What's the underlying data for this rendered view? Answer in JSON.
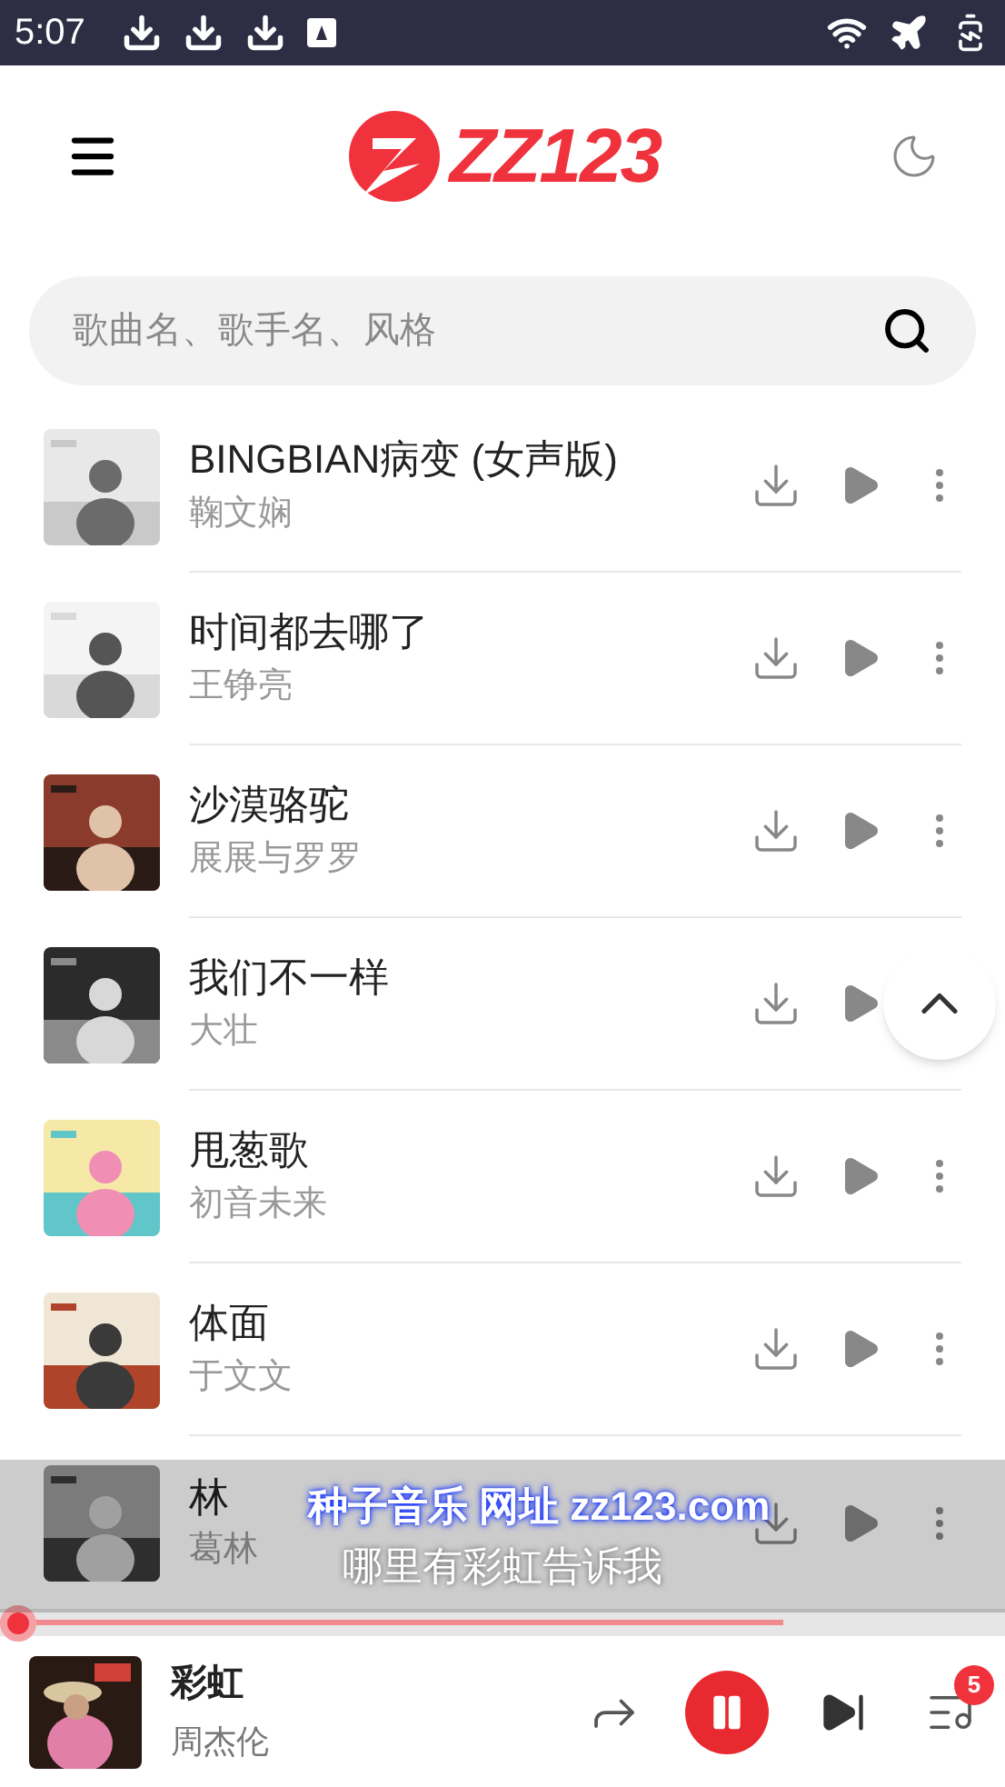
{
  "status_bar": {
    "time": "5:07"
  },
  "header": {
    "logo": "ZZ123"
  },
  "search": {
    "placeholder": "歌曲名、歌手名、风格"
  },
  "songs": [
    {
      "title": "BINGBIAN病变 (女声版)",
      "artist": "鞠文娴",
      "kind": "menu"
    },
    {
      "title": "时间都去哪了",
      "artist": "王铮亮",
      "kind": "menu"
    },
    {
      "title": "沙漠骆驼",
      "artist": "展展与罗罗",
      "kind": "menu"
    },
    {
      "title": "我们不一样",
      "artist": "大壮",
      "kind": "scroll_top"
    },
    {
      "title": "甩葱歌",
      "artist": "初音未来",
      "kind": "menu"
    },
    {
      "title": "体面",
      "artist": "于文文",
      "kind": "menu"
    },
    {
      "title": "林",
      "artist": "葛林",
      "kind": "menu"
    }
  ],
  "lyrics_overlay": {
    "site": "种子音乐 网址 zz123.com",
    "line": "哪里有彩虹告诉我"
  },
  "player": {
    "title": "彩虹",
    "artist": "周杰伦",
    "level": 0.78,
    "playing": true,
    "queue_count": "5"
  }
}
